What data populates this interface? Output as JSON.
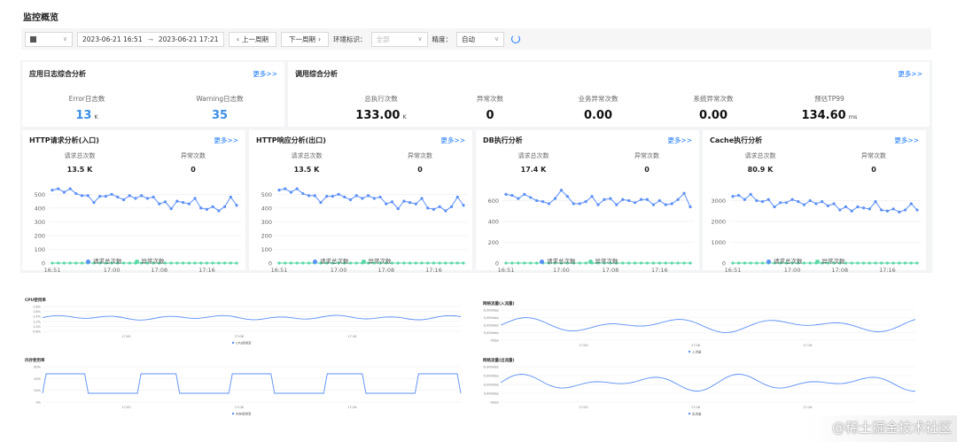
{
  "page": {
    "title": "监控概览"
  },
  "toolbar": {
    "date_start": "2023-06-21 16:51",
    "date_sep": "→",
    "date_end": "2023-06-21 17:21",
    "prev_label": "上一周期",
    "next_label": "下一周期",
    "env_label": "环境标识：",
    "env_value": "全部",
    "precision_label": "精度：",
    "precision_value": "自动"
  },
  "log_card": {
    "title": "应用日志综合分析",
    "more": "更多>>",
    "error_label": "Error日志数",
    "error_value": "13",
    "error_unit": "K",
    "warning_label": "Warning日志数",
    "warning_value": "35"
  },
  "call_card": {
    "title": "调用综合分析",
    "more": "更多>>",
    "stats": [
      {
        "label": "总执行次数",
        "value": "133.00",
        "unit": "K"
      },
      {
        "label": "异常次数",
        "value": "0",
        "unit": ""
      },
      {
        "label": "业务异常次数",
        "value": "0.00",
        "unit": ""
      },
      {
        "label": "系统异常次数",
        "value": "0.00",
        "unit": ""
      },
      {
        "label": "预估TP99",
        "value": "134.60",
        "unit": "ms"
      }
    ]
  },
  "legend": {
    "total": "请求总次数",
    "error": "异常次数"
  },
  "colors": {
    "blue": "#5b8ff9",
    "green": "#5ad8a6",
    "accent": "#1677ff"
  },
  "charts": [
    {
      "title": "HTTP请求分析(入口)",
      "more": "更多>>",
      "stat1_label": "请求总次数",
      "stat1_value": "13.5 K",
      "stat2_label": "异常次数",
      "stat2_value": "0",
      "chart_data": {
        "type": "line",
        "x_ticks": [
          "16:51",
          "17:00",
          "17:08",
          "17:16"
        ],
        "y_ticks": [
          0,
          100,
          200,
          300,
          400,
          500
        ],
        "ylim": [
          0,
          560
        ],
        "series": [
          {
            "name": "请求总次数",
            "values": [
              530,
              540,
              515,
              540,
              505,
              490,
              490,
              440,
              485,
              485,
              500,
              480,
              460,
              490,
              470,
              490,
              470,
              480,
              430,
              445,
              395,
              450,
              440,
              430,
              470,
              400,
              390,
              410,
              380,
              410,
              480,
              420
            ]
          },
          {
            "name": "异常次数",
            "values": [
              0,
              0,
              0,
              0,
              0,
              0,
              0,
              0,
              0,
              0,
              0,
              0,
              0,
              0,
              0,
              0,
              0,
              0,
              0,
              0,
              0,
              0,
              0,
              0,
              0,
              0,
              0,
              0,
              0,
              0,
              0,
              0
            ]
          }
        ]
      }
    },
    {
      "title": "HTTP响应分析(出口)",
      "more": "更多>>",
      "stat1_label": "请求总次数",
      "stat1_value": "13.5 K",
      "stat2_label": "异常次数",
      "stat2_value": "0",
      "chart_data": {
        "type": "line",
        "x_ticks": [
          "16:51",
          "17:00",
          "17:08",
          "17:16"
        ],
        "y_ticks": [
          0,
          100,
          200,
          300,
          400,
          500
        ],
        "ylim": [
          0,
          560
        ],
        "series": [
          {
            "name": "请求总次数",
            "values": [
              530,
              540,
              515,
              540,
              505,
              490,
              490,
              440,
              485,
              485,
              500,
              480,
              460,
              490,
              470,
              490,
              470,
              480,
              430,
              445,
              395,
              450,
              440,
              430,
              470,
              400,
              390,
              410,
              380,
              410,
              480,
              420
            ]
          },
          {
            "name": "异常次数",
            "values": [
              0,
              0,
              0,
              0,
              0,
              0,
              0,
              0,
              0,
              0,
              0,
              0,
              0,
              0,
              0,
              0,
              0,
              0,
              0,
              0,
              0,
              0,
              0,
              0,
              0,
              0,
              0,
              0,
              0,
              0,
              0,
              0
            ]
          }
        ]
      }
    },
    {
      "title": "DB执行分析",
      "more": "更多>>",
      "stat1_label": "请求总次数",
      "stat1_value": "17.4 K",
      "stat2_label": "异常次数",
      "stat2_value": "0",
      "chart_data": {
        "type": "line",
        "x_ticks": [
          "16:51",
          "17:00",
          "17:08",
          "17:16"
        ],
        "y_ticks": [
          0,
          200,
          400,
          600
        ],
        "ylim": [
          0,
          740
        ],
        "series": [
          {
            "name": "请求总次数",
            "values": [
              660,
              650,
              620,
              660,
              630,
              600,
              590,
              570,
              620,
              700,
              640,
              570,
              570,
              590,
              640,
              560,
              610,
              620,
              560,
              610,
              600,
              580,
              610,
              610,
              560,
              600,
              560,
              570,
              610,
              670,
              540
            ]
          },
          {
            "name": "异常次数",
            "values": [
              0,
              0,
              0,
              0,
              0,
              0,
              0,
              0,
              0,
              0,
              0,
              0,
              0,
              0,
              0,
              0,
              0,
              0,
              0,
              0,
              0,
              0,
              0,
              0,
              0,
              0,
              0,
              0,
              0,
              0,
              0
            ]
          }
        ]
      }
    },
    {
      "title": "Cache执行分析",
      "more": "更多>>",
      "stat1_label": "请求总次数",
      "stat1_value": "80.9 K",
      "stat2_label": "异常次数",
      "stat2_value": "0",
      "chart_data": {
        "type": "line",
        "x_ticks": [
          "16:51",
          "17:00",
          "17:08",
          "17:16"
        ],
        "y_ticks": [
          0,
          1000,
          2000,
          3000
        ],
        "ylim": [
          0,
          3700
        ],
        "series": [
          {
            "name": "请求总次数",
            "values": [
              3200,
              3250,
              3050,
              3300,
              3000,
              2950,
              3050,
              2700,
              2900,
              2900,
              3050,
              2950,
              2800,
              3000,
              2850,
              2950,
              2750,
              2850,
              2550,
              2700,
              2500,
              2700,
              2650,
              2600,
              2950,
              2550,
              2500,
              2600,
              2450,
              2550,
              2850,
              2550
            ]
          },
          {
            "name": "异常次数",
            "values": [
              0,
              0,
              0,
              0,
              0,
              0,
              0,
              0,
              0,
              0,
              0,
              0,
              0,
              0,
              0,
              0,
              0,
              0,
              0,
              0,
              0,
              0,
              0,
              0,
              0,
              0,
              0,
              0,
              0,
              0,
              0,
              0
            ]
          }
        ]
      }
    }
  ],
  "bottom": [
    {
      "title": "CPU使用率",
      "ticks": [
        "17:00",
        "17:08",
        "17:16"
      ],
      "legend": "CPU使用率",
      "y_ticks": [
        "1.8%",
        "1.6%",
        "1.4%",
        "1.2%",
        "1.0%",
        "0.8%"
      ]
    },
    {
      "title": "网络流量(入流量)",
      "ticks": [
        "17:00",
        "17:08",
        "17:16"
      ],
      "legend": "入流量",
      "y_ticks": [
        "20,000kb/s",
        "15,000kb/s",
        "10,000kb/s",
        "5,000kb/s",
        "0kb/s"
      ]
    },
    {
      "title": "内存使用率",
      "ticks": [
        "17:00",
        "17:08",
        "17:16"
      ],
      "legend": "内存使用率",
      "y_ticks": [
        "60%",
        "40%",
        "20%",
        "0%"
      ]
    },
    {
      "title": "网络流量(出流量)",
      "ticks": [
        "17:00",
        "17:08",
        "17:16"
      ],
      "legend": "出流量",
      "y_ticks": [
        "20,000kb/s",
        "15,000kb/s",
        "10,000kb/s",
        "5,000kb/s",
        "0kb/s"
      ]
    }
  ],
  "watermark": "@稀土掘金技术社区"
}
